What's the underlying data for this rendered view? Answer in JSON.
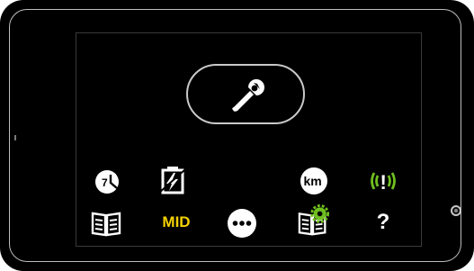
{
  "colors": {
    "device_body": "#000000",
    "bezel_edge": "#bdbdbd",
    "icon_white": "#ffffff",
    "accent_green": "#6fbf1f",
    "accent_yellow": "#f4d100"
  },
  "settings_button": {
    "icon": "wrench-icon"
  },
  "top_row": [
    {
      "name": "clock-icon",
      "label": "7"
    },
    {
      "name": "battery-flash-icon"
    },
    {
      "name": "km-icon",
      "label": "km"
    },
    {
      "name": "sensor-warning-icon",
      "label": "!"
    }
  ],
  "bottom_row": [
    {
      "name": "manual-book-icon"
    },
    {
      "name": "mid-button",
      "label": "MID"
    },
    {
      "name": "more-options-icon"
    },
    {
      "name": "book-settings-icon"
    },
    {
      "name": "help-button",
      "label": "?"
    }
  ]
}
